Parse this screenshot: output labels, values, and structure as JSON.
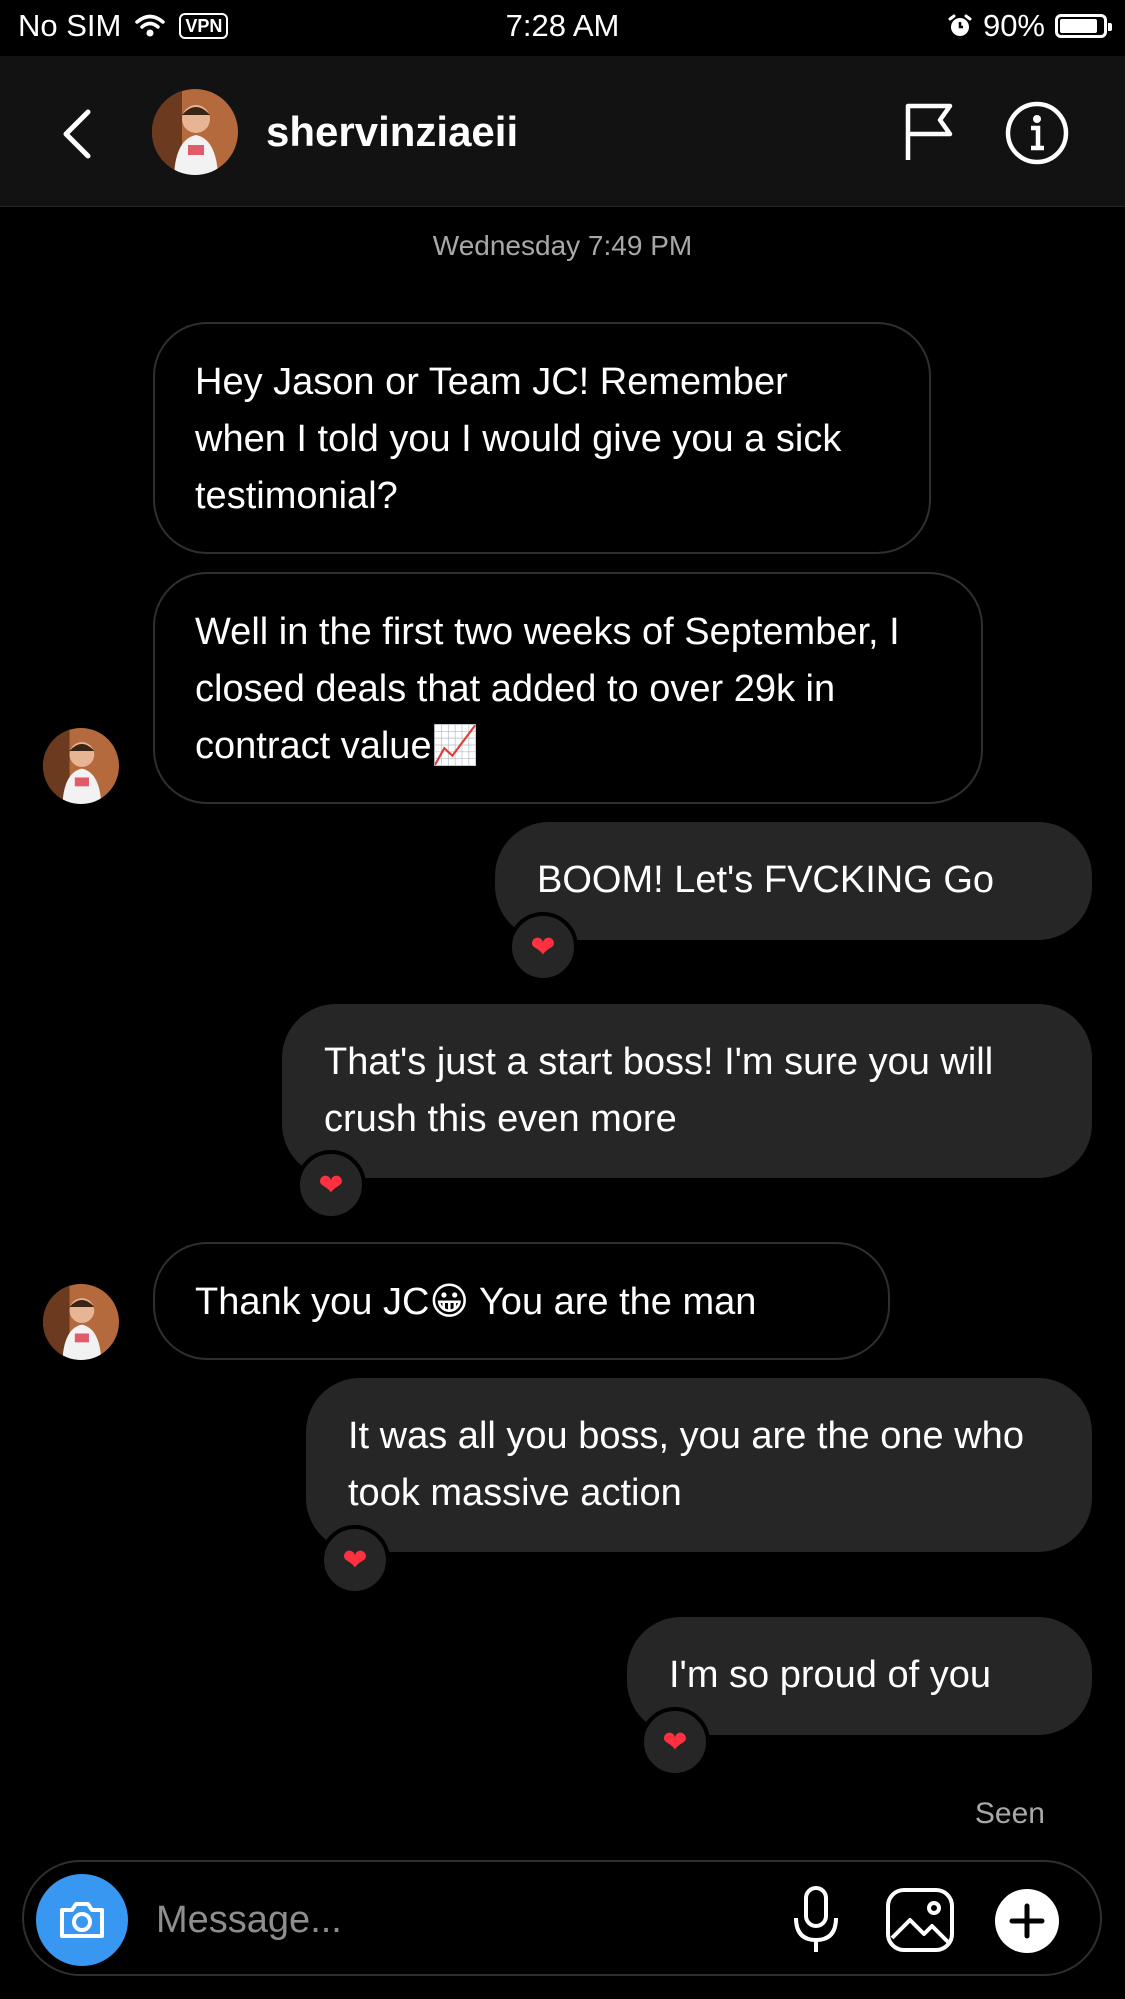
{
  "status_bar": {
    "carrier": "No SIM",
    "vpn": "VPN",
    "time": "7:28 AM",
    "battery": "90%",
    "battery_level": 0.9
  },
  "header": {
    "username": "shervinziaeii",
    "back_icon": "chevron-left-icon",
    "flag_icon": "flag-icon",
    "info_icon": "info-icon"
  },
  "thread": {
    "timestamp": "Wednesday 7:49 PM",
    "messages": [
      {
        "from": "them",
        "text": "Hey Jason or Team JC! Remember when I told you I would give you a sick testimonial?"
      },
      {
        "from": "them",
        "text": "Well in the first two weeks of September, I closed deals that added to over 29k in contract value",
        "emoji": "📈"
      },
      {
        "from": "me",
        "text": "BOOM! Let's FVCKING Go",
        "reaction": "❤"
      },
      {
        "from": "me",
        "text": "That's just a start boss! I'm sure you will crush this even more",
        "reaction": "❤"
      },
      {
        "from": "them",
        "text_before": "Thank you JC",
        "emoji": "😀",
        "text_after": "You are the man"
      },
      {
        "from": "me",
        "text": "It was all you boss, you are the one who took massive action",
        "reaction": "❤"
      },
      {
        "from": "me",
        "text": "I'm so proud of you",
        "reaction": "❤"
      }
    ],
    "seen": "Seen"
  },
  "composer": {
    "placeholder": "Message...",
    "icons": [
      "camera-icon",
      "microphone-icon",
      "gallery-icon",
      "plus-icon"
    ]
  },
  "colors": {
    "background": "#000000",
    "header_bg": "#121212",
    "outgoing_bubble": "#262626",
    "incoming_border": "#2f2f2f",
    "accent_blue": "#3897f0",
    "heart": "#ff3040",
    "muted_text": "#a8a8a8"
  }
}
